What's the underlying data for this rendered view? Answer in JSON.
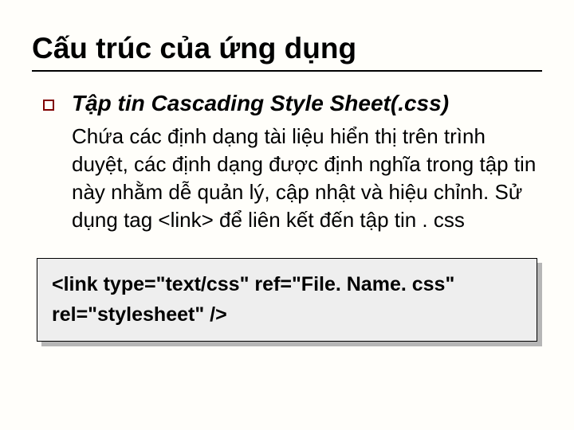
{
  "title": "Cấu trúc của ứng dụng",
  "subheading": "Tập tin Cascading Style Sheet(.css)",
  "body": "Chứa các định dạng tài liệu hiển thị trên trình duyệt, các định dạng được định nghĩa trong tập tin này nhằm dễ quản lý, cập nhật và hiệu chỉnh. Sử dụng tag <link> để liên kết đến tập tin . css",
  "code": "<link type=\"text/css\" ref=\"File. Name. css\" rel=\"stylesheet\" />"
}
